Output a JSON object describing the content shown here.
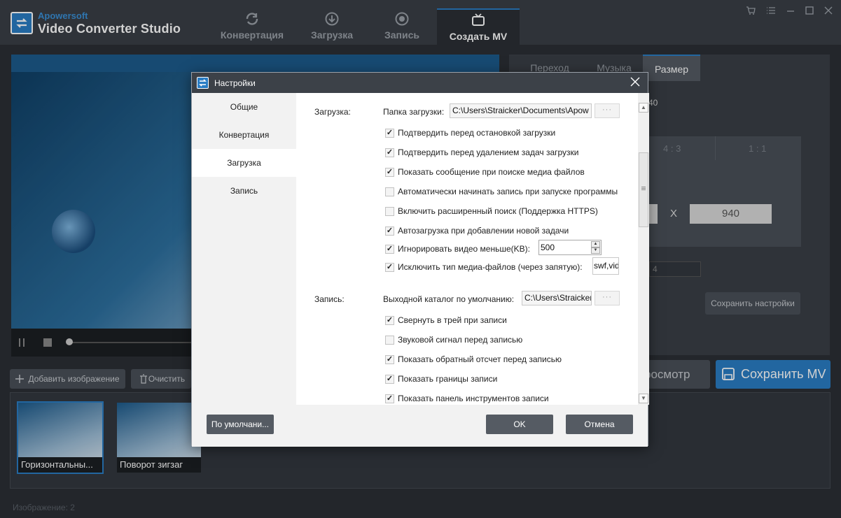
{
  "app": {
    "brand": "Apowersoft",
    "title": "Video Converter Studio"
  },
  "nav": {
    "tabs": [
      {
        "label": "Конвертация",
        "icon": "refresh-icon"
      },
      {
        "label": "Загрузка",
        "icon": "download-icon"
      },
      {
        "label": "Запись",
        "icon": "record-icon"
      },
      {
        "label": "Создать MV",
        "icon": "tv-icon"
      }
    ],
    "active": "Создать MV"
  },
  "right_panel": {
    "tabs": [
      "Переход",
      "Музыка",
      "Размер"
    ],
    "active_tab": "Размер",
    "size_partial": "40",
    "ratios": [
      "4 : 3",
      "1 : 1"
    ],
    "width_value": "",
    "x_label": "X",
    "height_value": "940",
    "spin_value": "4",
    "save_settings": "Сохранить настройки",
    "preview_button": "росмотр",
    "save_mv_button": "Сохранить MV"
  },
  "toolbar": {
    "add_image": "Добавить изображение",
    "clear": "Очистить"
  },
  "thumbnails": [
    {
      "caption": "Горизонтальны..."
    },
    {
      "caption": "Поворот зигзаг"
    }
  ],
  "status": "Изображение: 2",
  "dialog": {
    "title": "Настройки",
    "sidebar": [
      "Общие",
      "Конвертация",
      "Загрузка",
      "Запись"
    ],
    "active_section": "Загрузка",
    "download": {
      "section_label": "Загрузка:",
      "folder_label": "Папка загрузки:",
      "folder_path": "C:\\Users\\Straicker\\Documents\\Apow",
      "browse": "···",
      "options": [
        {
          "label": "Подтвердить перед остановкой загрузки",
          "checked": true
        },
        {
          "label": "Подтвердить перед удалением задач загрузки",
          "checked": true
        },
        {
          "label": "Показать сообщение при поиске медиа файлов",
          "checked": true
        },
        {
          "label": "Автоматически начинать запись при запуске программы",
          "checked": false
        },
        {
          "label": "Включить расширенный поиск (Поддержка HTTPS)",
          "checked": false
        },
        {
          "label": "Автозагрузка при добавлении новой задачи",
          "checked": true
        }
      ],
      "ignore_label": "Игнорировать видео меньше(KB):",
      "ignore_checked": true,
      "ignore_value": "500",
      "exclude_label": "Исключить тип медиа-файлов (через запятую):",
      "exclude_checked": true,
      "exclude_value": "swf,vid"
    },
    "record": {
      "section_label": "Запись:",
      "output_label": "Выходной каталог по умолчанию:",
      "output_path": "C:\\Users\\Straicker",
      "browse": "···",
      "options": [
        {
          "label": "Свернуть в трей при записи",
          "checked": true
        },
        {
          "label": "Звуковой сигнал перед записью",
          "checked": false
        },
        {
          "label": "Показать обратный отсчет перед записью",
          "checked": true
        },
        {
          "label": "Показать границы записи",
          "checked": true
        },
        {
          "label": "Показать панель инструментов записи",
          "checked": true
        }
      ]
    },
    "buttons": {
      "defaults": "По умолчани...",
      "ok": "OK",
      "cancel": "Отмена"
    }
  }
}
